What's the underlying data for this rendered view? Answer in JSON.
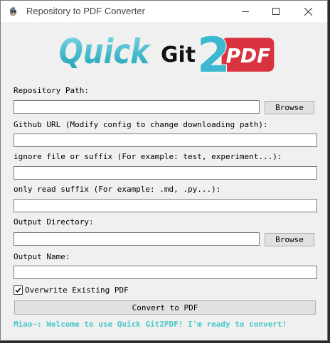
{
  "window": {
    "title": "Repository to PDF Converter"
  },
  "logo": {
    "quick": "Quick",
    "git": "Git",
    "two": "2",
    "pdf": "PDF"
  },
  "form": {
    "repo_path": {
      "label": "Repository Path:",
      "value": "",
      "browse": "Browse"
    },
    "github_url": {
      "label": "Github URL (Modify config to change downloading path):",
      "value": ""
    },
    "ignore": {
      "label": "ignore file or suffix (For example: test, experiment...):",
      "value": ""
    },
    "only_read": {
      "label": "only read suffix (For example: .md, .py...):",
      "value": ""
    },
    "output_dir": {
      "label": "Output Directory:",
      "value": "",
      "browse": "Browse"
    },
    "output_name": {
      "label": "Output Name:",
      "value": ""
    },
    "overwrite": {
      "label": "Overwrite Existing PDF",
      "checked": true
    },
    "convert": {
      "label": "Convert to PDF"
    }
  },
  "status": {
    "text": "Miao~: Welcome to use Quick Git2PDF! I'm ready to convert!"
  },
  "colors": {
    "quick_gradient_start": "#7fd8e4",
    "quick_gradient_end": "#1aa0b8",
    "pdf_red": "#d9333f",
    "status": "#48c8c8"
  }
}
